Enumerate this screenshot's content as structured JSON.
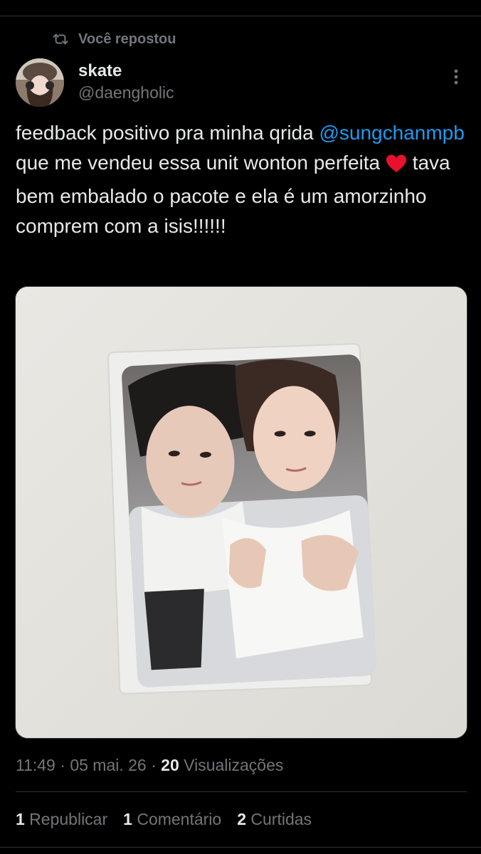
{
  "repost": {
    "label": "Você repostou",
    "icon": "repost-icon"
  },
  "author": {
    "name": "skate",
    "handle": "@daengholic",
    "avatar": "avatar"
  },
  "tweet": {
    "text_before": "feedback positivo pra minha qrida ",
    "mention": "@sungchanmpb",
    "text_middle": " que me vendeu essa unit wonton perfeita ",
    "emoji": "heart-emoji",
    "text_after": " tava bem embalado o pacote e ela é um amorzinho comprem com a isis!!!!!!"
  },
  "meta": {
    "time": "11:49",
    "sep1": " · ",
    "date": "05 mai. 26",
    "sep2": " · ",
    "views_count": "20",
    "views_label": " Visualizações"
  },
  "stats": {
    "reposts_count": "1",
    "reposts_label": " Republicar",
    "comments_count": "1",
    "comments_label": " Comentário",
    "likes_count": "2",
    "likes_label": " Curtidas"
  },
  "colors": {
    "background": "#000000",
    "text": "#e7e9ea",
    "muted": "#71767b",
    "link": "#1d9bf0",
    "divider": "#2f3336",
    "heart": "#f91880"
  }
}
